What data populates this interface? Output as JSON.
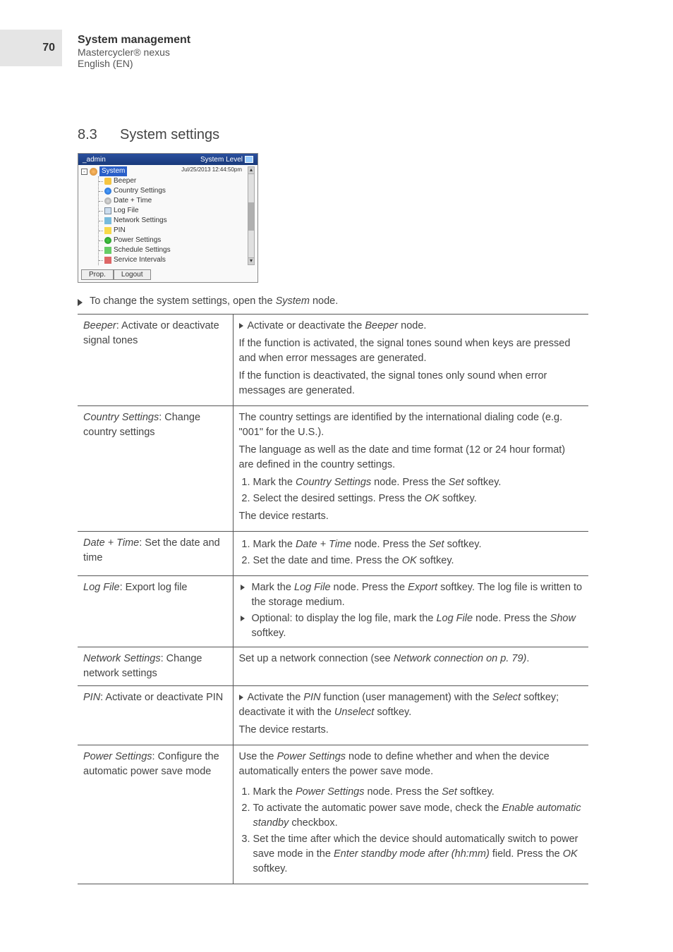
{
  "page_number": "70",
  "header": {
    "title": "System management",
    "product": "Mastercycler® nexus",
    "language": "English (EN)"
  },
  "section": {
    "number": "8.3",
    "title": "System settings"
  },
  "screenshot": {
    "user": "_admin",
    "level": "System Level",
    "timestamp": "Jul/25/2013 12:44:50pm",
    "root": "System",
    "items": [
      "Beeper",
      "Country Settings",
      "Date + Time",
      "Log File",
      "Network Settings",
      "PIN",
      "Power Settings",
      "Schedule Settings",
      "Service Intervals"
    ],
    "buttons": {
      "prop": "Prop.",
      "logout": "Logout"
    }
  },
  "intro": {
    "pre": "To change the system settings, open the ",
    "node": "System",
    "post": " node."
  },
  "rows": {
    "beeper": {
      "name": "Beeper",
      "desc": ": Activate or deactivate signal tones",
      "r_line1_pre": "Activate or deactivate the ",
      "r_line1_node": "Beeper",
      "r_line1_post": " node.",
      "r_line2": "If the function is activated, the signal tones sound when keys are pressed and when error messages are generated.",
      "r_line3": "If the function is deactivated, the signal tones only sound when error messages are generated."
    },
    "country": {
      "name": "Country Settings",
      "desc": ": Change country settings",
      "r_p1": "The country settings are identified by the international dialing code (e.g. \"001\" for the U.S.).",
      "r_p2": "The language as well as the date and time format (12 or 24 hour format) are defined in the country settings.",
      "s1_pre": "Mark the ",
      "s1_node": "Country Settings",
      "s1_mid": " node. Press the ",
      "s1_key": "Set",
      "s1_post": " softkey.",
      "s2_pre": "Select the desired settings. Press the ",
      "s2_key": "OK",
      "s2_post": " softkey.",
      "r_p3": "The device restarts."
    },
    "datetime": {
      "name": "Date + Time",
      "desc": ": Set the date and time",
      "s1_pre": "Mark the ",
      "s1_node": "Date + Time",
      "s1_mid": " node. Press the ",
      "s1_key": "Set",
      "s1_post": " softkey.",
      "s2_pre": "Set the date and time. Press the ",
      "s2_key": "OK",
      "s2_post": " softkey."
    },
    "logfile": {
      "name": "Log File",
      "desc": ": Export log file",
      "b1_pre": "Mark the ",
      "b1_node": "Log File",
      "b1_mid": " node. Press the ",
      "b1_key": "Export",
      "b1_post": " softkey. The log file is written to the storage medium.",
      "b2_pre": "Optional: to display the log file, mark the ",
      "b2_node": "Log File",
      "b2_mid": " node. Press the ",
      "b2_key": "Show",
      "b2_post": " softkey."
    },
    "network": {
      "name": "Network Settings",
      "desc": ": Change network settings",
      "r_pre": "Set up a network connection (see ",
      "r_ref": "Network connection on p. 79)",
      "r_post": "."
    },
    "pin": {
      "name": "PIN",
      "desc": ": Activate or deactivate PIN",
      "b1_pre": "Activate the ",
      "b1_node": "PIN",
      "b1_mid": " function (user management) with the ",
      "b1_key": "Select",
      "b1_mid2": " softkey; deactivate it with the ",
      "b1_key2": "Unselect",
      "b1_post": " softkey.",
      "r_p2": "The device restarts."
    },
    "power": {
      "name": "Power Settings",
      "desc": ": Configure the automatic power save mode",
      "r_p1_pre": "Use the ",
      "r_p1_node": "Power Settings",
      "r_p1_post": " node to define whether and when the device automatically enters the power save mode.",
      "s1_pre": "Mark the ",
      "s1_node": "Power Settings",
      "s1_mid": " node. Press the ",
      "s1_key": "Set",
      "s1_post": " softkey.",
      "s2_pre": "To activate the automatic power save mode, check the ",
      "s2_node": "Enable automatic standby",
      "s2_post": " checkbox.",
      "s3_pre": "Set the time after which the device should automatically switch to power save mode in the ",
      "s3_node": "Enter standby mode after (hh:mm)",
      "s3_mid": "   field. Press the ",
      "s3_key": "OK",
      "s3_post": " softkey."
    }
  }
}
